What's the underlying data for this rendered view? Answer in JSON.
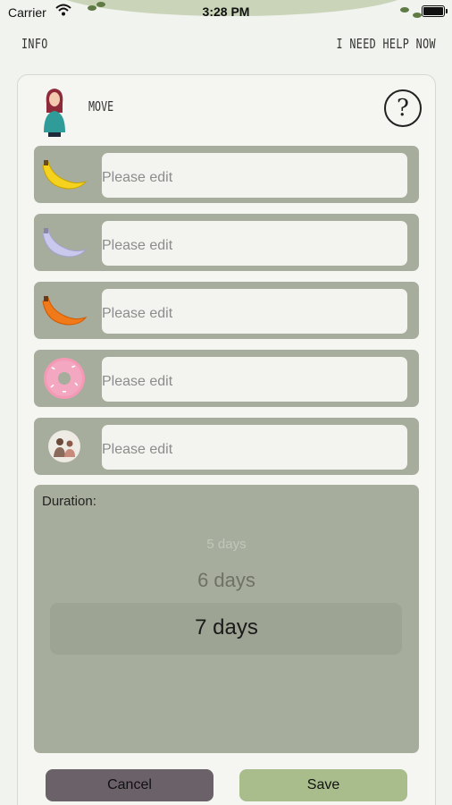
{
  "status_bar": {
    "carrier": "Carrier",
    "time": "3:28 PM"
  },
  "nav": {
    "info": "INFO",
    "help_now": "I NEED HELP NOW"
  },
  "section": {
    "title": "MOVE"
  },
  "entries": [
    {
      "icon": "yellow-banana-icon",
      "placeholder": "Please edit"
    },
    {
      "icon": "lavender-banana-icon",
      "placeholder": "Please edit"
    },
    {
      "icon": "orange-banana-icon",
      "placeholder": "Please edit"
    },
    {
      "icon": "pink-donut-icon",
      "placeholder": "Please edit"
    },
    {
      "icon": "people-circle-icon",
      "placeholder": "Please edit"
    }
  ],
  "duration": {
    "label": "Duration:",
    "options": [
      "5 days",
      "6 days",
      "7 days"
    ],
    "selected": "7 days"
  },
  "buttons": {
    "cancel": "Cancel",
    "save": "Save"
  },
  "colors": {
    "background": "#f1f3ee",
    "row_bg": "#a7ad9c",
    "cancel_bg": "#6b6168",
    "save_bg": "#a8bd8b"
  }
}
